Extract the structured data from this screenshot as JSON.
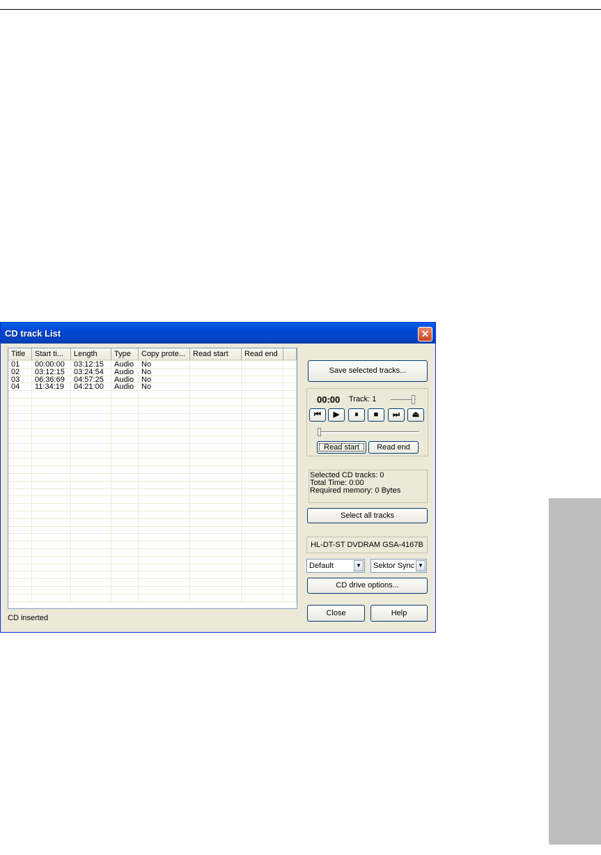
{
  "dialog": {
    "title": "CD track List",
    "close_glyph": "✕"
  },
  "table": {
    "columns": [
      "Title",
      "Start ti...",
      "Length",
      "Type",
      "Copy prote...",
      "Read start",
      "Read end"
    ],
    "rows": [
      [
        "01",
        "00:00:00",
        "03:12:15",
        "Audio",
        "No"
      ],
      [
        "02",
        "03:12:15",
        "03:24:54",
        "Audio",
        "No"
      ],
      [
        "03",
        "06:36:69",
        "04:57:25",
        "Audio",
        "No"
      ],
      [
        "04",
        "11:34:19",
        "04:21:00",
        "Audio",
        "No"
      ]
    ]
  },
  "status": "CD inserted",
  "actions": {
    "save_selected": "Save selected tracks...",
    "select_all": "Select all tracks",
    "drive_options": "CD drive options...",
    "close": "Close",
    "help": "Help"
  },
  "player": {
    "time": "00:00",
    "track": "Track: 1",
    "controls": {
      "prev": "⏮",
      "play": "▶",
      "pause": "⏸",
      "stop": "■",
      "next": "⏭",
      "eject": "⏏"
    },
    "read_start": "Read start",
    "read_end": "Read end"
  },
  "info": {
    "selected": "Selected CD tracks: 0",
    "total_time": "Total Time:  0:00",
    "memory": "Required memory: 0 Bytes"
  },
  "drive": {
    "name": "HL-DT-ST DVDRAM GSA-4167B",
    "mode": "Default",
    "sync": "Sektor Sync"
  }
}
